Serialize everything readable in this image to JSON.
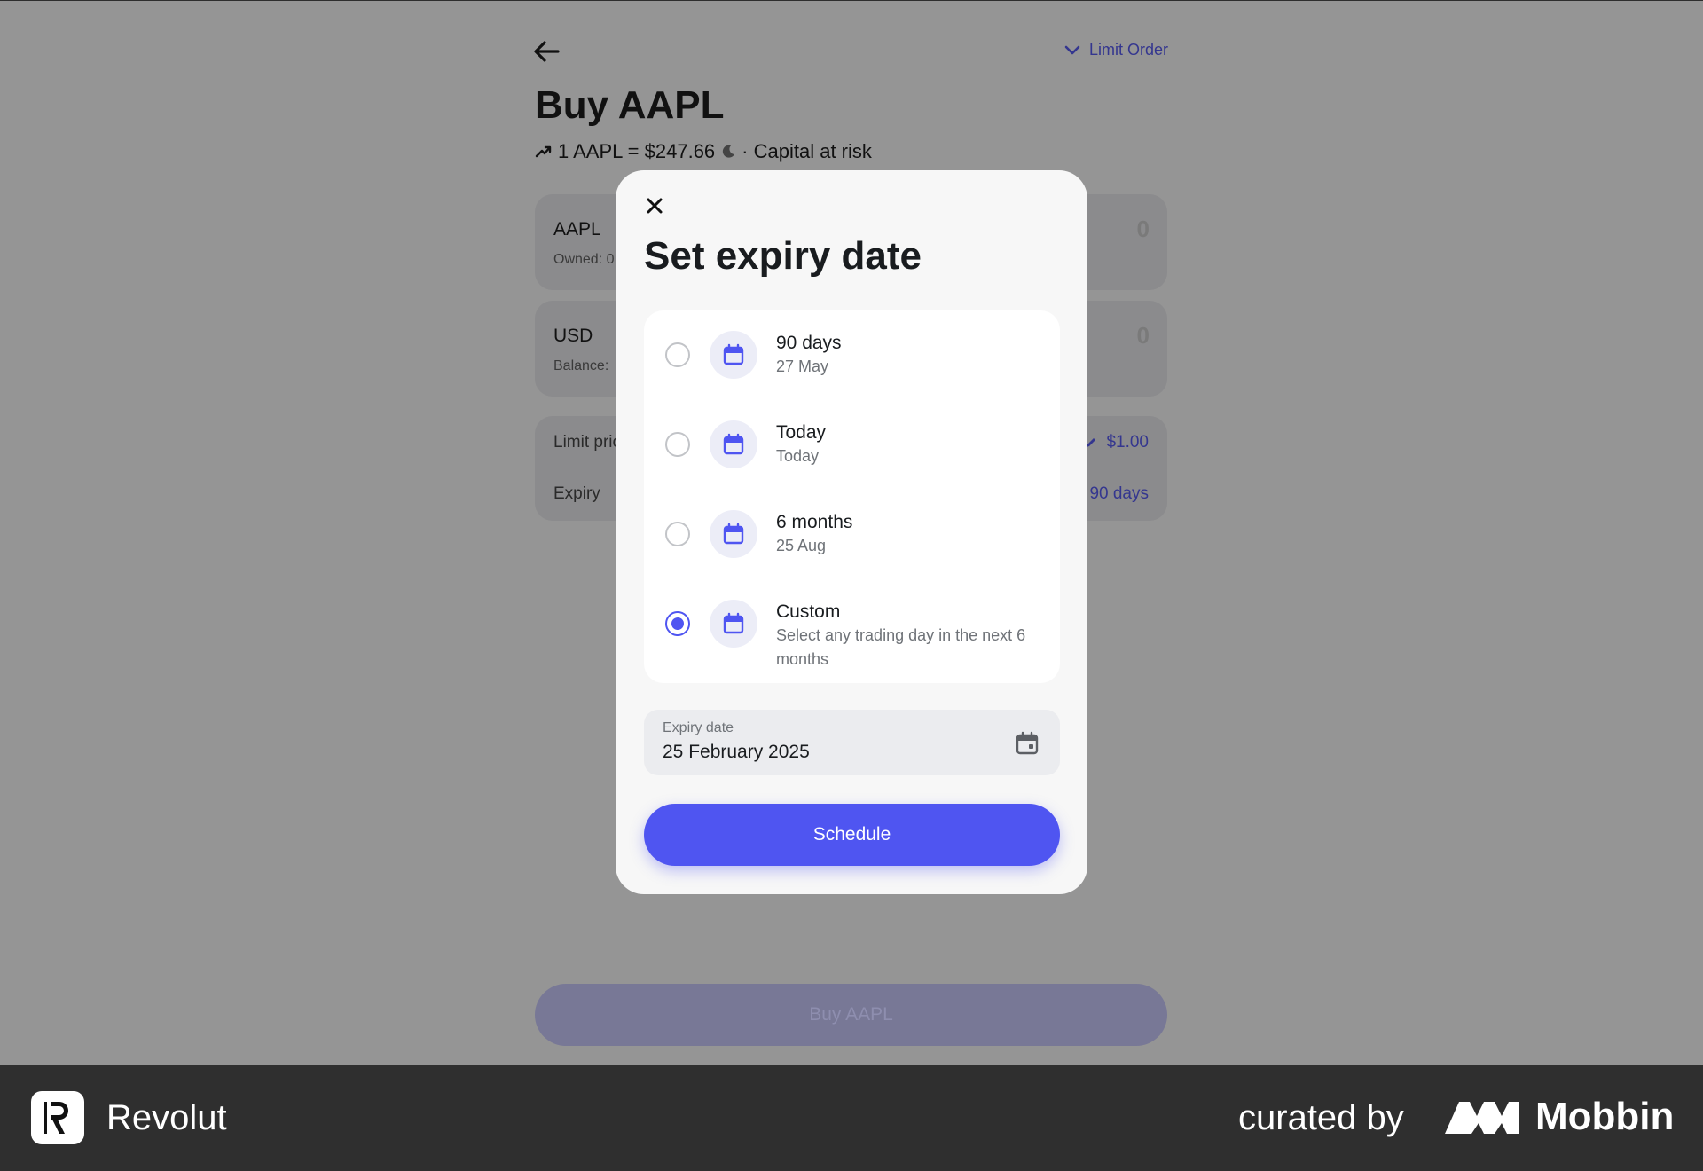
{
  "header": {
    "order_type": "Limit Order",
    "title": "Buy AAPL",
    "rate": "1 AAPL = $247.66",
    "risk": "· Capital at risk"
  },
  "cards": {
    "asset_label": "AAPL",
    "asset_sub": "Owned: 0",
    "asset_amount": "0",
    "cash_label": "USD",
    "cash_sub": "Balance:",
    "cash_amount": "0",
    "limit_price_label": "Limit price",
    "limit_price_value": "$1.00",
    "expiry_label": "Expiry",
    "expiry_value": "90 days"
  },
  "buy_button": "Buy AAPL",
  "modal": {
    "title": "Set expiry date",
    "options": [
      {
        "title": "90 days",
        "subtitle": "27 May",
        "selected": false
      },
      {
        "title": "Today",
        "subtitle": "Today",
        "selected": false
      },
      {
        "title": "6 months",
        "subtitle": "25 Aug",
        "selected": false
      },
      {
        "title": "Custom",
        "subtitle": "Select any trading day in the next 6 months",
        "selected": true
      }
    ],
    "date_field": {
      "label": "Expiry date",
      "value": "25 February 2025"
    },
    "schedule_button": "Schedule"
  },
  "footer": {
    "brand": "Revolut",
    "curated_by": "curated by",
    "curator": "Mobbin"
  },
  "colors": {
    "accent": "#4f55f1",
    "link": "#34368f",
    "overlay": "#959595",
    "footer": "#2f2f2f"
  }
}
